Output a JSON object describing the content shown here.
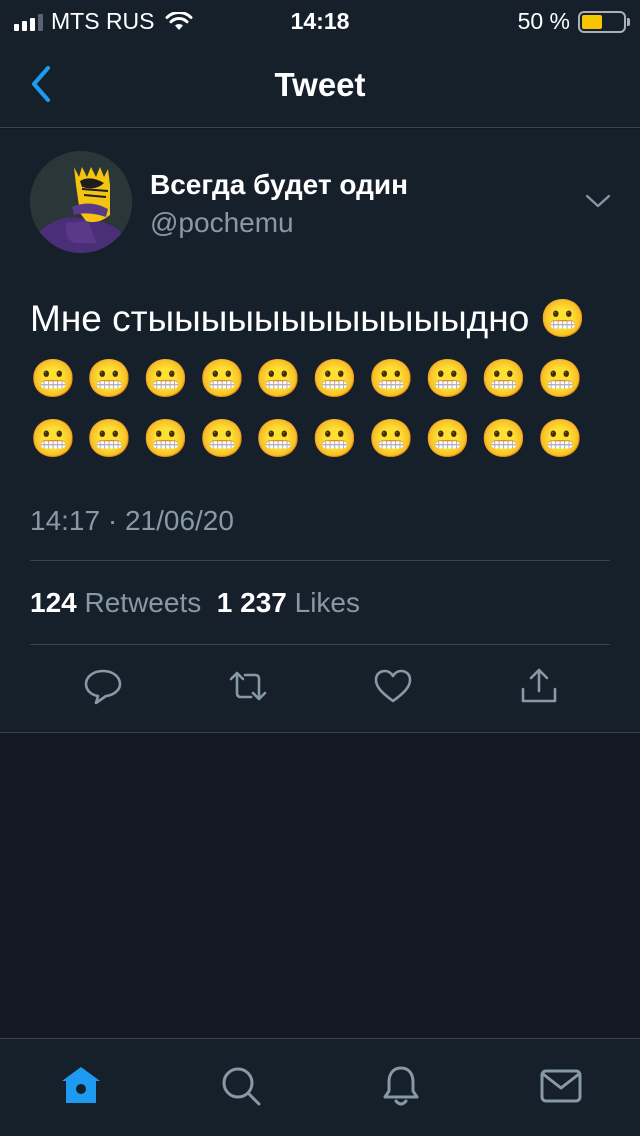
{
  "status_bar": {
    "carrier": "MTS RUS",
    "time": "14:18",
    "battery": "50 %",
    "battery_level": 0.5
  },
  "nav": {
    "title": "Tweet",
    "back_icon": "chevron-left-icon"
  },
  "tweet": {
    "author": {
      "display_name": "Всегда будет один",
      "handle": "@pochemu"
    },
    "text": "Мне стыыыыыыыыыыыыдно 😬 😬 😬 😬 😬 😬 😬 😬 😬 😬 😬 😬 😬 😬 😬 😬 😬 😬 😬 😬 😬",
    "timestamp": "14:17 · 21/06/20",
    "retweets_count": "124",
    "retweets_label": "Retweets",
    "likes_count": "1 237",
    "likes_label": "Likes",
    "actions": [
      "reply-icon",
      "retweet-icon",
      "like-icon",
      "share-icon"
    ]
  },
  "tab_bar": {
    "tabs": [
      "home-icon",
      "search-icon",
      "notifications-icon",
      "messages-icon"
    ],
    "active": "home-icon"
  },
  "colors": {
    "accent": "#1d9bf0",
    "background": "#15202b",
    "secondary_text": "#8899a6"
  }
}
